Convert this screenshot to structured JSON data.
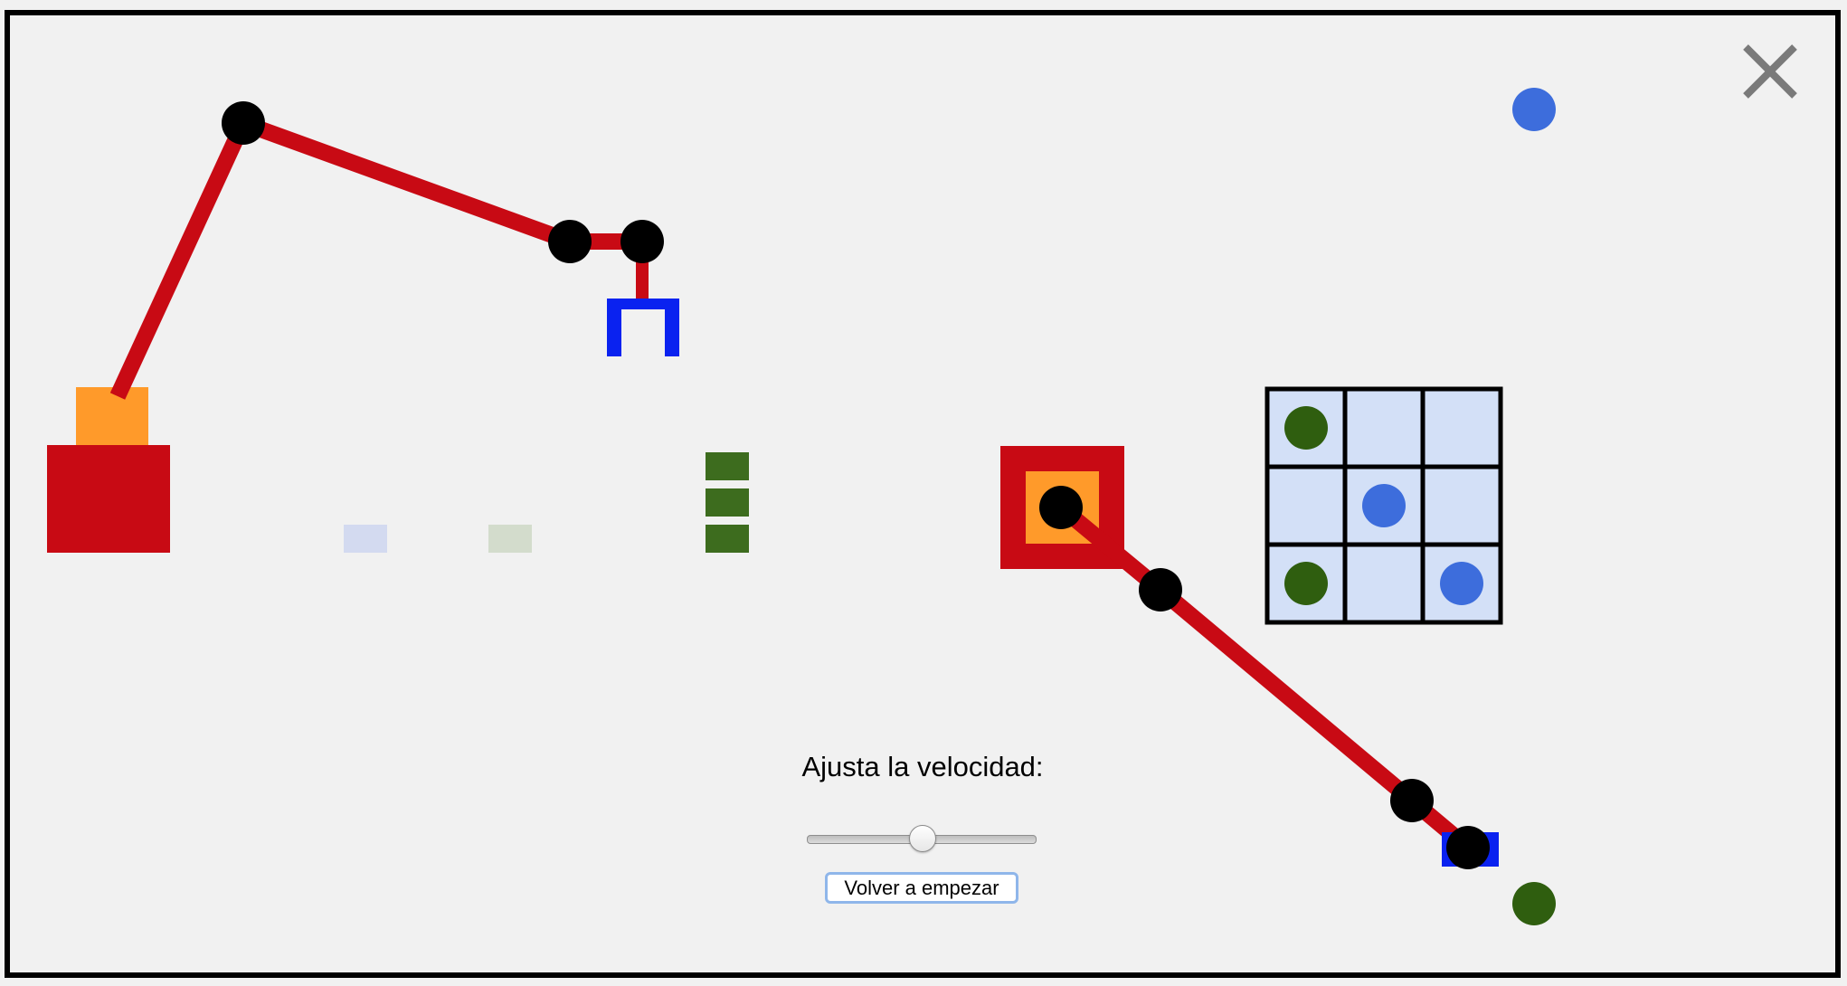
{
  "controls": {
    "speed_label": "Ajusta la velocidad:",
    "speed_value": 0.5,
    "restart_label": "Volver a empezar"
  },
  "icons": {
    "close": "close-x-icon"
  },
  "colors": {
    "background": "#f1f1f1",
    "frame": "#000000",
    "arm": "#c80a14",
    "joint": "#000000",
    "base_orange": "#ff9a2a",
    "gripper_blue": "#0a22f0",
    "target_blue": "#3d6ddc",
    "target_green": "#2f5e0f",
    "stack_green": "#3d6c1e",
    "grid_fill": "#d3e0f7",
    "close_icon": "#7a7a7a",
    "ghost_blue": "#d3daf0",
    "ghost_green": "#d3dccc"
  },
  "grid": {
    "rows": 3,
    "cols": 3,
    "cells": [
      [
        "green",
        "",
        ""
      ],
      [
        "",
        "blue",
        ""
      ],
      [
        "green",
        "",
        "blue"
      ]
    ]
  }
}
